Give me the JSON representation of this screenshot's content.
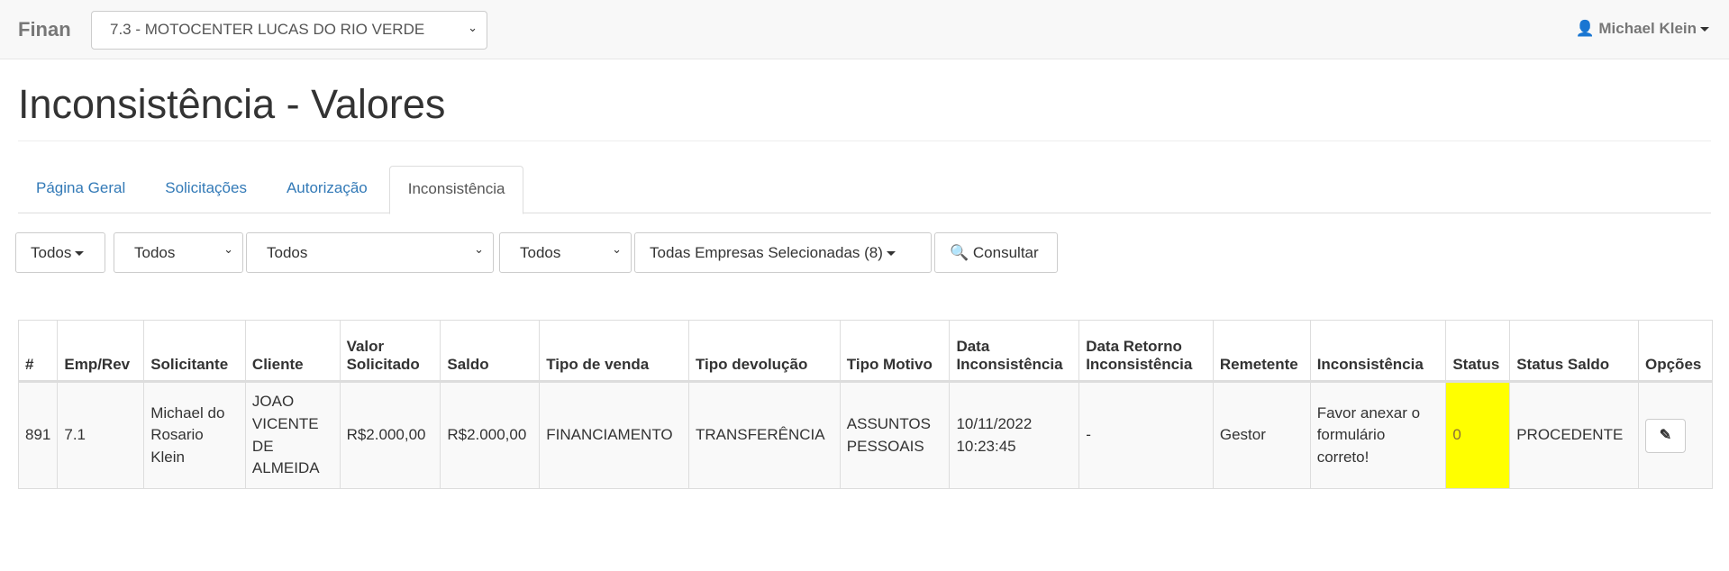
{
  "navbar": {
    "brand": "Finan",
    "company": "7.3 - MOTOCENTER LUCAS DO RIO VERDE",
    "user": "Michael Klein"
  },
  "page_title": "Inconsistência - Valores",
  "tabs": [
    {
      "label": "Página Geral"
    },
    {
      "label": "Solicitações"
    },
    {
      "label": "Autorização"
    },
    {
      "label": "Inconsistência",
      "active": true
    }
  ],
  "filters": {
    "f1": "Todos",
    "f2": "Todos",
    "f3": "Todos",
    "f4": "Todos",
    "empresas": "Todas Empresas Selecionadas (8)",
    "consultar": "Consultar"
  },
  "table": {
    "headers": [
      "#",
      "Emp/Rev",
      "Solicitante",
      "Cliente",
      "Valor Solicitado",
      "Saldo",
      "Tipo de venda",
      "Tipo devolução",
      "Tipo Motivo",
      "Data Inconsistência",
      "Data Retorno Inconsistência",
      "Remetente",
      "Inconsistência",
      "Status",
      "Status Saldo",
      "Opções"
    ],
    "rows": [
      [
        "891",
        "7.1",
        "Michael do Rosario Klein",
        "JOAO VICENTE DE ALMEIDA",
        "R$2.000,00",
        "R$2.000,00",
        "FINANCIAMENTO",
        "TRANSFERÊNCIA",
        "ASSUNTOS PESSOAIS",
        "10/11/2022 10:23:45",
        "-",
        "Gestor",
        "Favor anexar o formulário correto!",
        "0",
        "PROCEDENTE"
      ]
    ],
    "status_color": "#ffff00"
  }
}
